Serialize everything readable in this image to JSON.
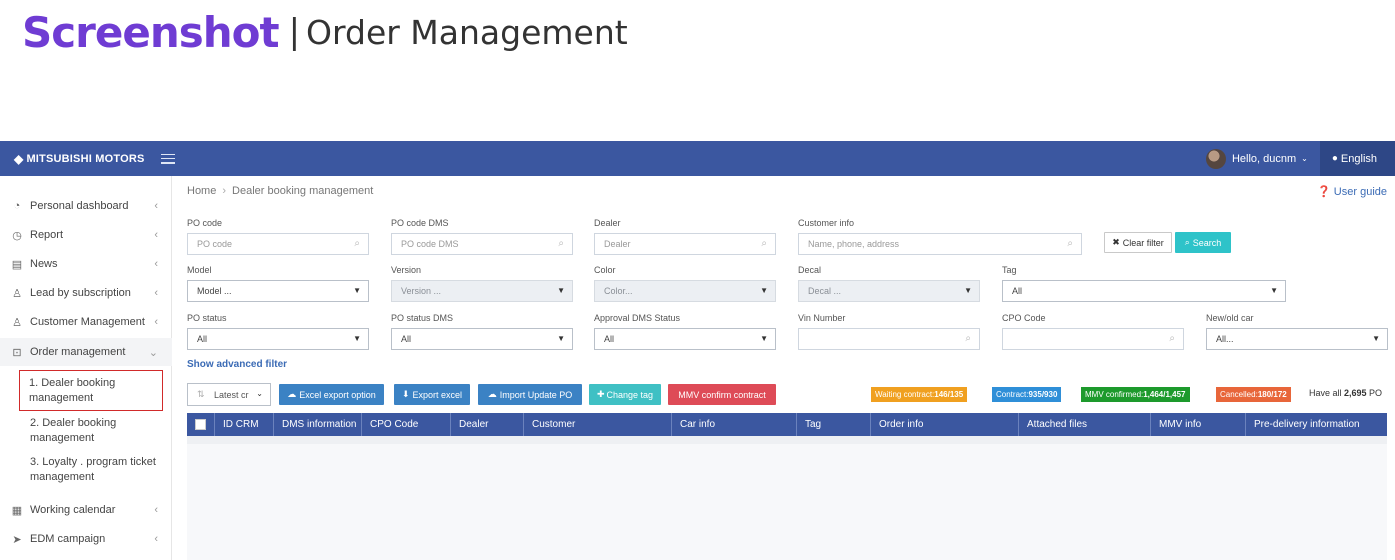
{
  "banner": {
    "brand": "Screenshot",
    "separator": "|",
    "subtitle": "Order Management"
  },
  "topbar": {
    "logo": "MITSUBISHI MOTORS",
    "user": "Hello, ducnm",
    "language": "English"
  },
  "sidebar": {
    "items": [
      {
        "label": "Personal dashboard"
      },
      {
        "label": "Report"
      },
      {
        "label": "News"
      },
      {
        "label": "Lead by subscription"
      },
      {
        "label": "Customer Management"
      },
      {
        "label": "Order management"
      },
      {
        "label": "Working calendar"
      },
      {
        "label": "EDM campaign"
      }
    ],
    "subitems": [
      {
        "label": "1. Dealer booking management"
      },
      {
        "label": "2. Dealer booking management"
      },
      {
        "label": "3. Loyalty . program ticket management"
      }
    ]
  },
  "breadcrumb": {
    "home": "Home",
    "current": "Dealer booking management"
  },
  "user_guide": "User guide",
  "filters": {
    "po_code": {
      "label": "PO code",
      "placeholder": "PO code"
    },
    "po_code_dms": {
      "label": "PO code DMS",
      "placeholder": "PO code DMS"
    },
    "dealer": {
      "label": "Dealer",
      "placeholder": "Dealer"
    },
    "customer_info": {
      "label": "Customer info",
      "placeholder": "Name, phone, address"
    },
    "model": {
      "label": "Model",
      "value": "Model ..."
    },
    "version": {
      "label": "Version",
      "value": "Version ..."
    },
    "color": {
      "label": "Color",
      "value": "Color..."
    },
    "decal": {
      "label": "Decal",
      "value": "Decal ..."
    },
    "tag": {
      "label": "Tag",
      "value": "All"
    },
    "po_status": {
      "label": "PO status",
      "value": "All"
    },
    "po_status_dms": {
      "label": "PO status DMS",
      "value": "All"
    },
    "approval_dms": {
      "label": "Approval DMS Status",
      "value": "All"
    },
    "vin": {
      "label": "Vin Number",
      "value": ""
    },
    "cpo": {
      "label": "CPO Code",
      "value": ""
    },
    "new_old": {
      "label": "New/old car",
      "value": "All..."
    }
  },
  "actions": {
    "clear_filter": "Clear filter",
    "search": "Search",
    "show_advanced": "Show advanced filter",
    "sort": "Latest cr",
    "excel_export_option": "Excel export option",
    "export_excel": "Export excel",
    "import_update_po": "Import Update PO",
    "change_tag": "Change tag",
    "mmv_confirm": "MMV confirm contract"
  },
  "badges": {
    "waiting": {
      "label": "Waiting contract: ",
      "count": "146/135",
      "color": "#f0a020"
    },
    "contract": {
      "label": "Contract: ",
      "count": "935/930",
      "color": "#2f8fd8"
    },
    "mmv": {
      "label": "MMV confirmed: ",
      "count": "1,464/1,457",
      "color": "#1d9a2c"
    },
    "cancelled": {
      "label": "Cancelled: ",
      "count": "180/172",
      "color": "#e8663a"
    }
  },
  "total": {
    "prefix": "Have all ",
    "count": "2,695",
    "suffix": " PO"
  },
  "table": {
    "headers": [
      "ID CRM",
      "DMS information",
      "CPO Code",
      "Dealer",
      "Customer",
      "Car info",
      "Tag",
      "Order info",
      "Attached files",
      "MMV info",
      "Pre-delivery information"
    ]
  },
  "colors": {
    "nav": "#3b57a0",
    "brand": "#6f3cd3",
    "link": "#3b6bb5"
  }
}
